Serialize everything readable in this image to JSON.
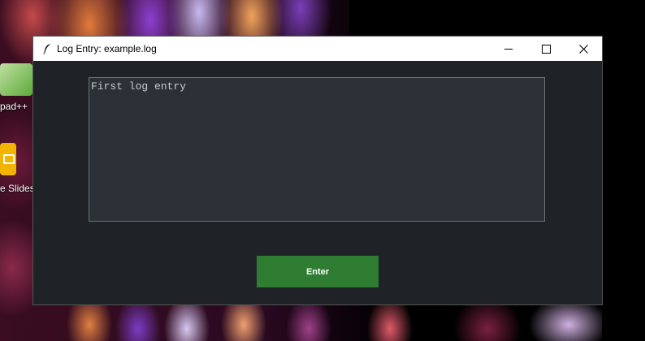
{
  "desktop": {
    "icons": [
      {
        "label": "pad++",
        "icon": "notepad-plus-plus-icon"
      },
      {
        "label": "e Slides",
        "icon": "google-slides-icon"
      }
    ]
  },
  "window": {
    "title": "Log Entry: example.log",
    "title_icon": "feather-icon",
    "controls": [
      "minimize-icon",
      "maximize-icon",
      "close-icon"
    ]
  },
  "log_entry": {
    "value": "First log entry"
  },
  "actions": {
    "enter_label": "Enter"
  },
  "colors": {
    "window_bg": "#1f2327",
    "textarea_bg": "#2b3137",
    "button_bg": "#2e7d32",
    "button_text": "#ffffff"
  }
}
